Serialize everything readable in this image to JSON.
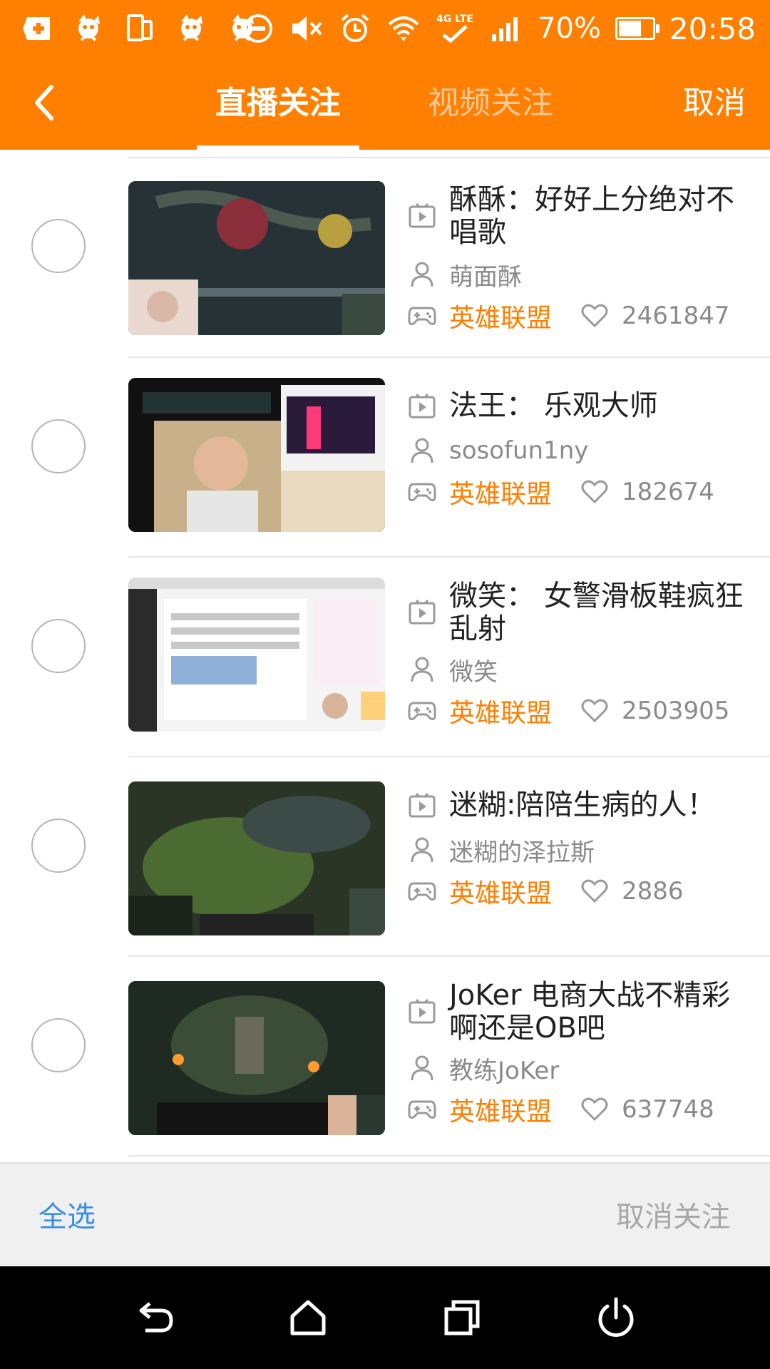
{
  "status_bar": {
    "battery_percent": "70%",
    "battery_level": 0.7,
    "time": "20:58",
    "network_label": "4G LTE"
  },
  "header": {
    "back_icon": "chevron-left-icon",
    "tabs": [
      {
        "label": "直播关注",
        "active": true
      },
      {
        "label": "视频关注",
        "active": false
      }
    ],
    "cancel_label": "取消"
  },
  "list": {
    "items": [
      {
        "title": "酥酥：好好上分绝对不唱歌",
        "streamer": "萌面酥",
        "category": "英雄联盟",
        "likes": "2461847",
        "checked": false
      },
      {
        "title": "法王： 乐观大师",
        "streamer": "sosofun1ny",
        "category": "英雄联盟",
        "likes": "182674",
        "checked": false
      },
      {
        "title": "微笑： 女警滑板鞋疯狂乱射",
        "streamer": "微笑",
        "category": "英雄联盟",
        "likes": "2503905",
        "checked": false
      },
      {
        "title": "迷糊:陪陪生病的人！",
        "streamer": "迷糊的泽拉斯",
        "category": "英雄联盟",
        "likes": "2886",
        "checked": false
      },
      {
        "title": "JoKer 电商大战不精彩啊还是OB吧",
        "streamer": "教练JoKer",
        "category": "英雄联盟",
        "likes": "637748",
        "checked": false
      }
    ]
  },
  "action_bar": {
    "select_all_label": "全选",
    "unfollow_label": "取消关注"
  },
  "colors": {
    "accent": "#ff7f00",
    "link_blue": "#3a8ee6",
    "text_gray": "#8a8a8a",
    "nav_background": "#000000"
  },
  "nav_bar": {
    "buttons": [
      "back-icon",
      "home-icon",
      "recents-icon",
      "power-icon"
    ]
  }
}
